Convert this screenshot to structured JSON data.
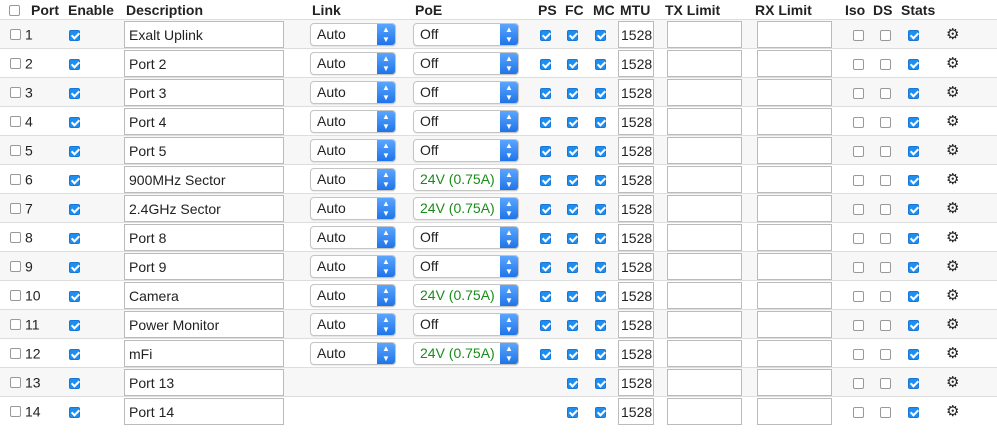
{
  "headers": {
    "port": "Port",
    "enable": "Enable",
    "description": "Description",
    "link": "Link",
    "poe": "PoE",
    "ps": "PS",
    "fc": "FC",
    "mc": "MC",
    "mtu": "MTU",
    "tx_limit": "TX Limit",
    "rx_limit": "RX Limit",
    "iso": "Iso",
    "ds": "DS",
    "stats": "Stats"
  },
  "settings_icon": "gear-icon",
  "colors": {
    "checkbox_checked": "#1e8ff0",
    "poe_active_text": "#1a8c1a",
    "select_arrow": "#1f74e8"
  },
  "rows": [
    {
      "port": "1",
      "desc": "Exalt Uplink",
      "link": "Auto",
      "poe": "Off",
      "ps": true,
      "mtu": "1528",
      "tx": "",
      "rx": ""
    },
    {
      "port": "2",
      "desc": "Port 2",
      "link": "Auto",
      "poe": "Off",
      "ps": true,
      "mtu": "1528",
      "tx": "",
      "rx": ""
    },
    {
      "port": "3",
      "desc": "Port 3",
      "link": "Auto",
      "poe": "Off",
      "ps": true,
      "mtu": "1528",
      "tx": "",
      "rx": ""
    },
    {
      "port": "4",
      "desc": "Port 4",
      "link": "Auto",
      "poe": "Off",
      "ps": true,
      "mtu": "1528",
      "tx": "",
      "rx": ""
    },
    {
      "port": "5",
      "desc": "Port 5",
      "link": "Auto",
      "poe": "Off",
      "ps": true,
      "mtu": "1528",
      "tx": "",
      "rx": ""
    },
    {
      "port": "6",
      "desc": "900MHz Sector",
      "link": "Auto",
      "poe": "24V (0.75A)",
      "ps": true,
      "mtu": "1528",
      "tx": "",
      "rx": ""
    },
    {
      "port": "7",
      "desc": "2.4GHz Sector",
      "link": "Auto",
      "poe": "24V (0.75A)",
      "ps": true,
      "mtu": "1528",
      "tx": "",
      "rx": ""
    },
    {
      "port": "8",
      "desc": "Port 8",
      "link": "Auto",
      "poe": "Off",
      "ps": true,
      "mtu": "1528",
      "tx": "",
      "rx": ""
    },
    {
      "port": "9",
      "desc": "Port 9",
      "link": "Auto",
      "poe": "Off",
      "ps": true,
      "mtu": "1528",
      "tx": "",
      "rx": ""
    },
    {
      "port": "10",
      "desc": "Camera",
      "link": "Auto",
      "poe": "24V (0.75A)",
      "ps": true,
      "mtu": "1528",
      "tx": "",
      "rx": ""
    },
    {
      "port": "11",
      "desc": "Power Monitor",
      "link": "Auto",
      "poe": "Off",
      "ps": true,
      "mtu": "1528",
      "tx": "",
      "rx": ""
    },
    {
      "port": "12",
      "desc": "mFi",
      "link": "Auto",
      "poe": "24V (0.75A)",
      "ps": true,
      "mtu": "1528",
      "tx": "",
      "rx": ""
    },
    {
      "port": "13",
      "desc": "Port 13",
      "link": "",
      "poe": "",
      "ps": false,
      "mtu": "1528",
      "tx": "",
      "rx": ""
    },
    {
      "port": "14",
      "desc": "Port 14",
      "link": "",
      "poe": "",
      "ps": false,
      "mtu": "1528",
      "tx": "",
      "rx": ""
    }
  ]
}
